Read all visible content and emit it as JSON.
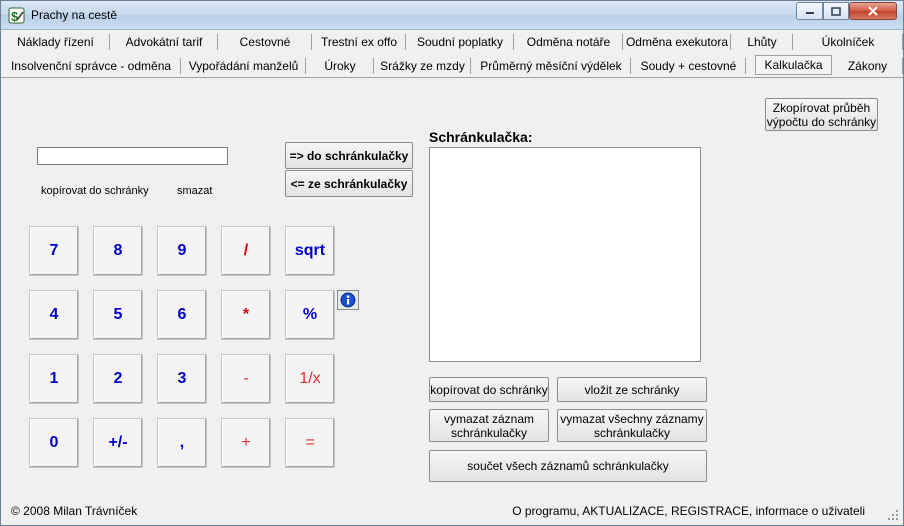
{
  "window": {
    "title": "Prachy na cestě"
  },
  "tabs_row1": [
    "Náklady řízení",
    "Advokátní tarif",
    "Cestovné",
    "Trestní ex offo",
    "Soudní poplatky",
    "Odměna notáře",
    "Odměna exekutora",
    "Lhůty",
    "Úkolníček"
  ],
  "tabs_row2": [
    "Insolvenční správce - odměna",
    "Vypořádání manželů",
    "Úroky",
    "Srážky ze mzdy",
    "Průměrný měsíční výdělek",
    "Soudy + cestovné",
    "Kalkulačka",
    "Zákony"
  ],
  "active_tab": "Kalkulačka",
  "calc": {
    "display_value": "",
    "copy_label": "kopírovat do schránky",
    "clear_label": "smazat",
    "to_clip_button": "=> do schránkulačky",
    "from_clip_button": "<= ze schránkulačky",
    "keys": [
      [
        "7",
        "8",
        "9",
        "/",
        "sqrt"
      ],
      [
        "4",
        "5",
        "6",
        "*",
        "%"
      ],
      [
        "1",
        "2",
        "3",
        "-",
        "1/x"
      ],
      [
        "0",
        "+/-",
        ",",
        "+",
        "="
      ]
    ]
  },
  "clipboard": {
    "title": "Schránkulačka:",
    "copy_history_button": "Zkopírovat průběh výpočtu do schránky",
    "copy_button": "kopírovat do schránky",
    "paste_button": "vložit ze schránky",
    "delete_one_button": "vymazat záznam schránkulačky",
    "delete_all_button": "vymazat všechny záznamy schránkulačky",
    "sum_button": "součet všech záznamů schránkulačky"
  },
  "status": {
    "copyright": "© 2008 Milan Trávníček",
    "about": "O programu, AKTUALIZACE, REGISTRACE, informace o uživateli"
  },
  "colors": {
    "digit": "#0000cc",
    "operator": "#dd0000",
    "titlebar": "#c4d8ee",
    "close": "#c2432b"
  },
  "icons": {
    "app": "money-icon",
    "info": "info-icon"
  }
}
